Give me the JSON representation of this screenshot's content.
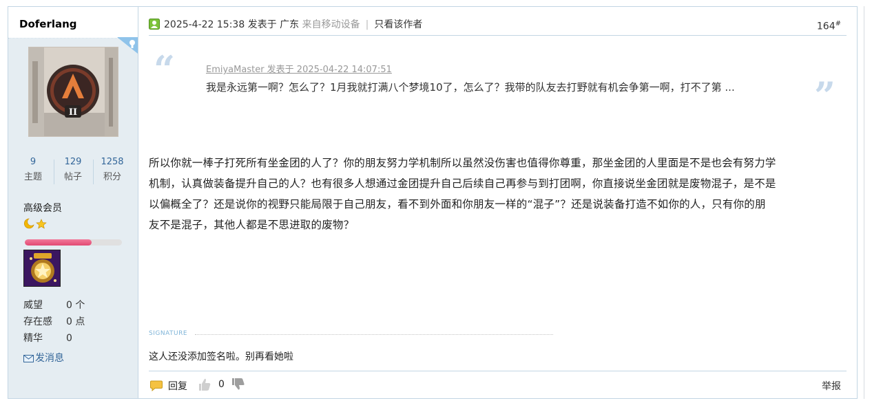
{
  "author": {
    "name": "Doferlang",
    "stats": [
      {
        "value": "9",
        "label": "主题"
      },
      {
        "value": "129",
        "label": "帖子"
      },
      {
        "value": "1258",
        "label": "积分"
      }
    ],
    "group": "高级会员",
    "progress": 0.69,
    "info": [
      {
        "key": "威望",
        "value": "0 个"
      },
      {
        "key": "存在感",
        "value": "0 点"
      },
      {
        "key": "精华",
        "value": "0"
      }
    ],
    "send_message": "发消息"
  },
  "post": {
    "date": "2025-4-22 15:38",
    "posted_at": "发表于",
    "location": "广东",
    "device": "来自移动设备",
    "separator": "|",
    "only_author": "只看该作者",
    "floor": "164",
    "floor_mark": "#"
  },
  "quote": {
    "meta": "EmiyaMaster 发表于 2025-04-22 14:07:51",
    "text": "我是永远第一啊？怎么了？1月我就打满八个梦境10了，怎么了？我带的队友去打野就有机会争第一啊，打不了第 ..."
  },
  "content": {
    "lines": [
      "所以你就一棒子打死所有坐金团的人了？你的朋友努力学机制所以虽然没伤害也值得你尊重，那坐金团的人里面是不是也会有努力学",
      "机制，认真做装备提升自己的人？也有很多人想通过金团提升自己后续自己再参与到打团啊，你直接说坐金团就是废物混子，是不是",
      "以偏概全了？还是说你的视野只能局限于自己朋友，看不到外面和你朋友一样的“混子”？还是说装备打造不如你的人，只有你的朋",
      "友不是混子，其他人都是不思进取的废物？"
    ]
  },
  "signature": {
    "label": "SIGNATURE",
    "text": "这人还没添加签名啦。别再看她啦"
  },
  "actions": {
    "reply": "回复",
    "like_count": "0",
    "report": "举报"
  },
  "colors": {
    "sidebar_bg": "#e5edf2",
    "border": "#c2d5e3",
    "link": "#336699",
    "quote_mark": "#c7d9eb",
    "progress": "#e14a73"
  }
}
